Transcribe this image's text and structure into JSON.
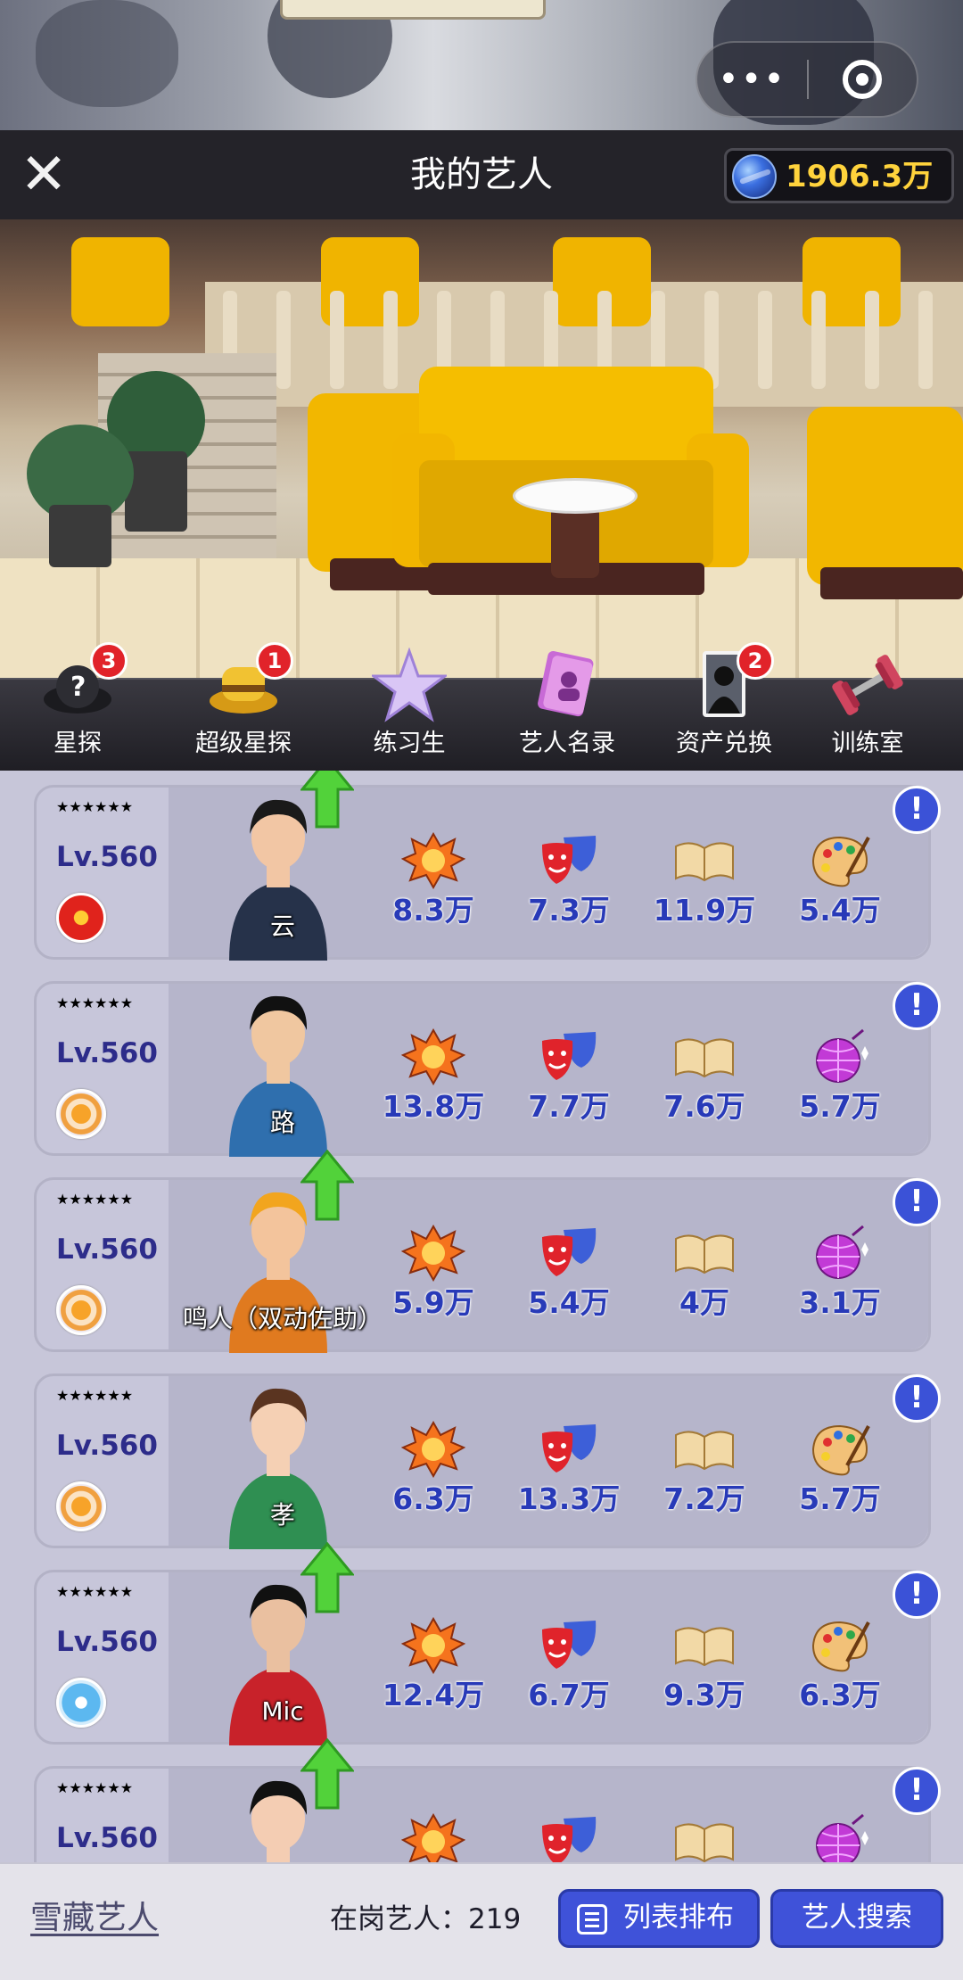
{
  "header": {
    "title": "我的艺人",
    "coins": "1906.3万"
  },
  "menu": [
    {
      "label": "星探",
      "badge": "3",
      "icon": "question-hat-icon"
    },
    {
      "label": "超级星探",
      "badge": "1",
      "icon": "golden-hat-icon"
    },
    {
      "label": "练习生",
      "badge": "",
      "icon": "crystal-star-icon"
    },
    {
      "label": "艺人名录",
      "badge": "",
      "icon": "artist-directory-icon"
    },
    {
      "label": "资产兑换",
      "badge": "2",
      "icon": "silhouette-card-icon"
    },
    {
      "label": "训练室",
      "badge": "",
      "icon": "dumbbell-icon"
    }
  ],
  "artists": [
    {
      "name": "云",
      "stars": "★★★★★★",
      "level": "Lv.560",
      "emblem": "red-star-emblem",
      "arrow": true,
      "stats": [
        "8.3万",
        "7.3万",
        "11.9万",
        "5.4万"
      ],
      "fourth_icon": "palette-icon"
    },
    {
      "name": "路",
      "stars": "★★★★★★",
      "level": "Lv.560",
      "emblem": "orange-flower-emblem",
      "arrow": false,
      "stats": [
        "13.8万",
        "7.7万",
        "7.6万",
        "5.7万"
      ],
      "fourth_icon": "disco-ball-icon"
    },
    {
      "name": "鸣人（双动佐助）",
      "stars": "★★★★★★",
      "level": "Lv.560",
      "emblem": "orange-flower-emblem",
      "arrow": true,
      "stats": [
        "5.9万",
        "5.4万",
        "4万",
        "3.1万"
      ],
      "fourth_icon": "disco-ball-icon"
    },
    {
      "name": "孝",
      "stars": "★★★★★★",
      "level": "Lv.560",
      "emblem": "orange-flower-emblem",
      "arrow": false,
      "stats": [
        "6.3万",
        "13.3万",
        "7.2万",
        "5.7万"
      ],
      "fourth_icon": "palette-icon"
    },
    {
      "name": "Mic",
      "stars": "★★★★★★",
      "level": "Lv.560",
      "emblem": "blue-bag-emblem",
      "arrow": true,
      "stats": [
        "12.4万",
        "6.7万",
        "9.3万",
        "6.3万"
      ],
      "fourth_icon": "palette-icon"
    },
    {
      "name": "",
      "stars": "★★★★★★",
      "level": "Lv.560",
      "emblem": "",
      "arrow": true,
      "stats": [
        "",
        "",
        "",
        ""
      ],
      "fourth_icon": "disco-ball-icon"
    }
  ],
  "footer": {
    "title": "雪藏艺人",
    "on_duty_label": "在岗艺人：",
    "on_duty_count": "219",
    "list_button": "列表排布",
    "search_button": "艺人搜索"
  },
  "colors": {
    "accent_blue": "#3f52d9",
    "star_pink": "#e24be6",
    "stat_blue": "#283ab8",
    "coin_gold": "#ffd33c",
    "badge_red": "#e1232a"
  }
}
